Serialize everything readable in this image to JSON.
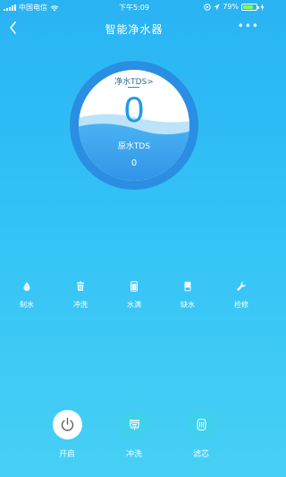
{
  "status_bar": {
    "carrier": "中国电信",
    "time": "下午5:09",
    "battery": "79%",
    "battery_level": 0.79
  },
  "nav": {
    "title": "智能净水器",
    "more": "•••"
  },
  "gauge": {
    "pure_label": "净水TDS>",
    "pure_value": "0",
    "raw_label": "原水TDS",
    "raw_value": "0"
  },
  "status_items": [
    {
      "label": "制水",
      "icon": "water-drop-icon"
    },
    {
      "label": "冲洗",
      "icon": "flush-icon"
    },
    {
      "label": "水满",
      "icon": "water-full-icon"
    },
    {
      "label": "缺水",
      "icon": "water-shortage-icon"
    },
    {
      "label": "检修",
      "icon": "wrench-icon"
    }
  ],
  "actions": [
    {
      "label": "开启",
      "icon": "power-icon"
    },
    {
      "label": "冲洗",
      "icon": "flush-icon"
    },
    {
      "label": "滤芯",
      "icon": "filter-icon"
    }
  ],
  "colors": {
    "accent": "#1e9be6",
    "gauge_ring": "#2a8ee2",
    "water": "#3aa7ef"
  }
}
